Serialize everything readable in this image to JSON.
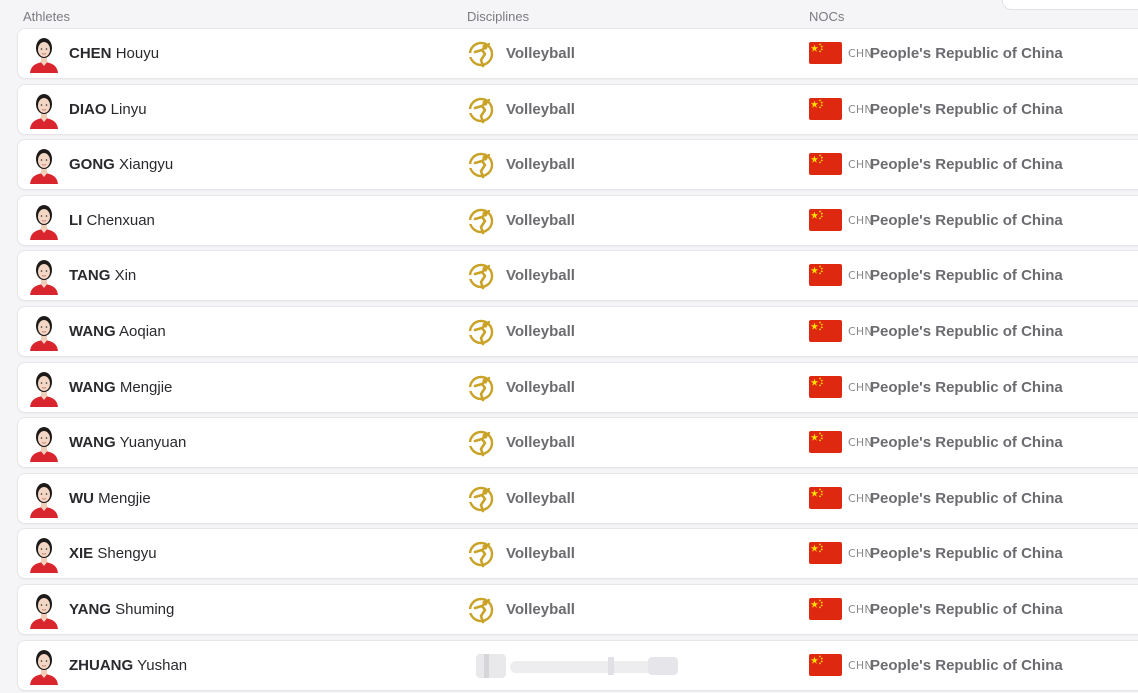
{
  "header": {
    "athletes": "Athletes",
    "disciplines": "Disciplines",
    "nocs": "NOCs"
  },
  "colors": {
    "flag_red": "#DE2910",
    "flag_star": "#FFDE00",
    "discipline_gold": "#C9A227",
    "jersey_red": "#D8252E"
  },
  "rows": [
    {
      "last": "CHEN",
      "first": "Houyu",
      "discipline": "Volleyball",
      "noc_code": "CHN",
      "noc_name": "People's Republic of China"
    },
    {
      "last": "DIAO",
      "first": "Linyu",
      "discipline": "Volleyball",
      "noc_code": "CHN",
      "noc_name": "People's Republic of China"
    },
    {
      "last": "GONG",
      "first": "Xiangyu",
      "discipline": "Volleyball",
      "noc_code": "CHN",
      "noc_name": "People's Republic of China"
    },
    {
      "last": "LI",
      "first": "Chenxuan",
      "discipline": "Volleyball",
      "noc_code": "CHN",
      "noc_name": "People's Republic of China"
    },
    {
      "last": "TANG",
      "first": "Xin",
      "discipline": "Volleyball",
      "noc_code": "CHN",
      "noc_name": "People's Republic of China"
    },
    {
      "last": "WANG",
      "first": "Aoqian",
      "discipline": "Volleyball",
      "noc_code": "CHN",
      "noc_name": "People's Republic of China"
    },
    {
      "last": "WANG",
      "first": "Mengjie",
      "discipline": "Volleyball",
      "noc_code": "CHN",
      "noc_name": "People's Republic of China"
    },
    {
      "last": "WANG",
      "first": "Yuanyuan",
      "discipline": "Volleyball",
      "noc_code": "CHN",
      "noc_name": "People's Republic of China"
    },
    {
      "last": "WU",
      "first": "Mengjie",
      "discipline": "Volleyball",
      "noc_code": "CHN",
      "noc_name": "People's Republic of China"
    },
    {
      "last": "XIE",
      "first": "Shengyu",
      "discipline": "Volleyball",
      "noc_code": "CHN",
      "noc_name": "People's Republic of China"
    },
    {
      "last": "YANG",
      "first": "Shuming",
      "discipline": "Volleyball",
      "noc_code": "CHN",
      "noc_name": "People's Republic of China"
    },
    {
      "last": "ZHUANG",
      "first": "Yushan",
      "discipline": "",
      "noc_code": "CHN",
      "noc_name": "People's Republic of China"
    }
  ]
}
